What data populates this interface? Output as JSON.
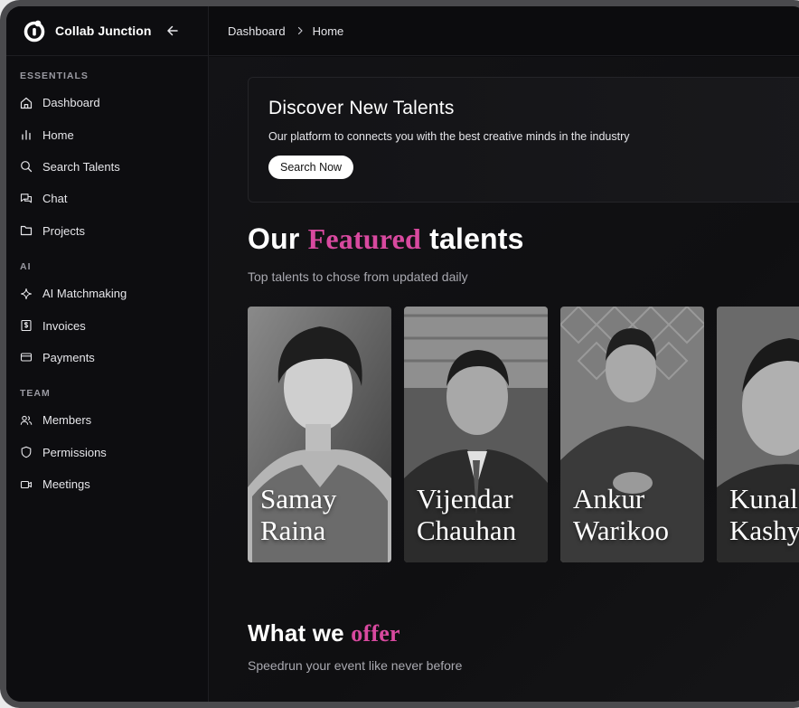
{
  "brand": {
    "name": "Collab Junction"
  },
  "sidebar": {
    "sections": [
      {
        "label": "ESSENTIALS",
        "items": [
          {
            "label": "Dashboard",
            "icon": "home-icon"
          },
          {
            "label": "Home",
            "icon": "bar-chart-icon"
          },
          {
            "label": "Search Talents",
            "icon": "search-icon"
          },
          {
            "label": "Chat",
            "icon": "chat-icon"
          },
          {
            "label": "Projects",
            "icon": "folder-icon"
          }
        ]
      },
      {
        "label": "AI",
        "items": [
          {
            "label": "AI Matchmaking",
            "icon": "sparkle-icon"
          },
          {
            "label": "Invoices",
            "icon": "invoice-icon"
          },
          {
            "label": "Payments",
            "icon": "card-icon"
          }
        ]
      },
      {
        "label": "TEAM",
        "items": [
          {
            "label": "Members",
            "icon": "users-icon"
          },
          {
            "label": "Permissions",
            "icon": "shield-icon"
          },
          {
            "label": "Meetings",
            "icon": "video-icon"
          }
        ]
      }
    ]
  },
  "breadcrumb": {
    "parent": "Dashboard",
    "current": "Home"
  },
  "hero": {
    "title": "Discover New Talents",
    "subtitle": "Our platform to connects you with the best creative minds in the industry",
    "button": "Search Now"
  },
  "featured": {
    "title_pre": "Our ",
    "title_accent": "Featured",
    "title_post": " talents",
    "subtitle": "Top talents to chose from updated daily",
    "talents": [
      {
        "first": "Samay",
        "last": "Raina"
      },
      {
        "first": "Vijendar",
        "last": "Chauhan"
      },
      {
        "first": "Ankur",
        "last": "Warikoo"
      },
      {
        "first": "Kunal",
        "last": "Kashyap"
      }
    ]
  },
  "offer": {
    "title_pre": "What we ",
    "title_accent": "offer",
    "subtitle": "Speedrun your event like never before"
  },
  "colors": {
    "accent": "#d8499f",
    "background": "#0c0c0e"
  }
}
